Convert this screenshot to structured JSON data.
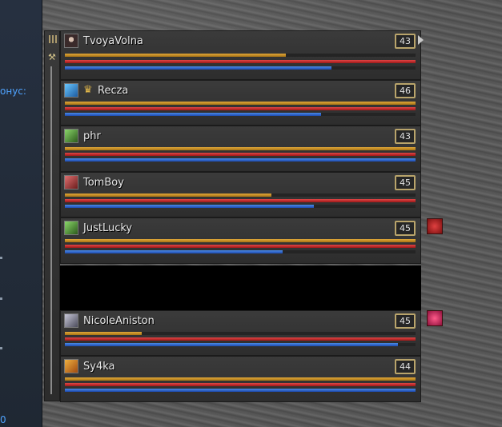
{
  "left_panel": {
    "fragment_text": "онус:",
    "bottom_text": "0"
  },
  "colors": {
    "cp": "#c98f24",
    "hp": "#c02a2a",
    "mp": "#2f6ad0",
    "level_border": "#b9a46b",
    "buff": "#c0202a"
  },
  "party": {
    "members": [
      {
        "name": "TvoyaVolna",
        "level": "43",
        "icon": "portrait-icon",
        "leader": false,
        "cp": 0.63,
        "hp": 1.0,
        "mp": 0.76
      },
      {
        "name": "Recza",
        "level": "46",
        "icon": "mage-icon",
        "leader": true,
        "cp": 1.0,
        "hp": 1.0,
        "mp": 0.73
      },
      {
        "name": "phr",
        "level": "43",
        "icon": "archer-icon",
        "leader": false,
        "cp": 1.0,
        "hp": 1.0,
        "mp": 1.0
      },
      {
        "name": "TomBoy",
        "level": "45",
        "icon": "warrior-icon",
        "leader": false,
        "cp": 0.59,
        "hp": 1.0,
        "mp": 0.71
      },
      {
        "name": "JustLucky",
        "level": "45",
        "icon": "archer-icon",
        "leader": false,
        "cp": 1.0,
        "hp": 1.0,
        "mp": 0.62
      },
      {
        "name": "NicoleAniston",
        "level": "45",
        "icon": "knight-icon",
        "leader": false,
        "cp": 0.22,
        "hp": 1.0,
        "mp": 0.95
      },
      {
        "name": "Sy4ka",
        "level": "44",
        "icon": "dagger-icon",
        "leader": false,
        "cp": 1.0,
        "hp": 1.0,
        "mp": 1.0
      }
    ]
  }
}
